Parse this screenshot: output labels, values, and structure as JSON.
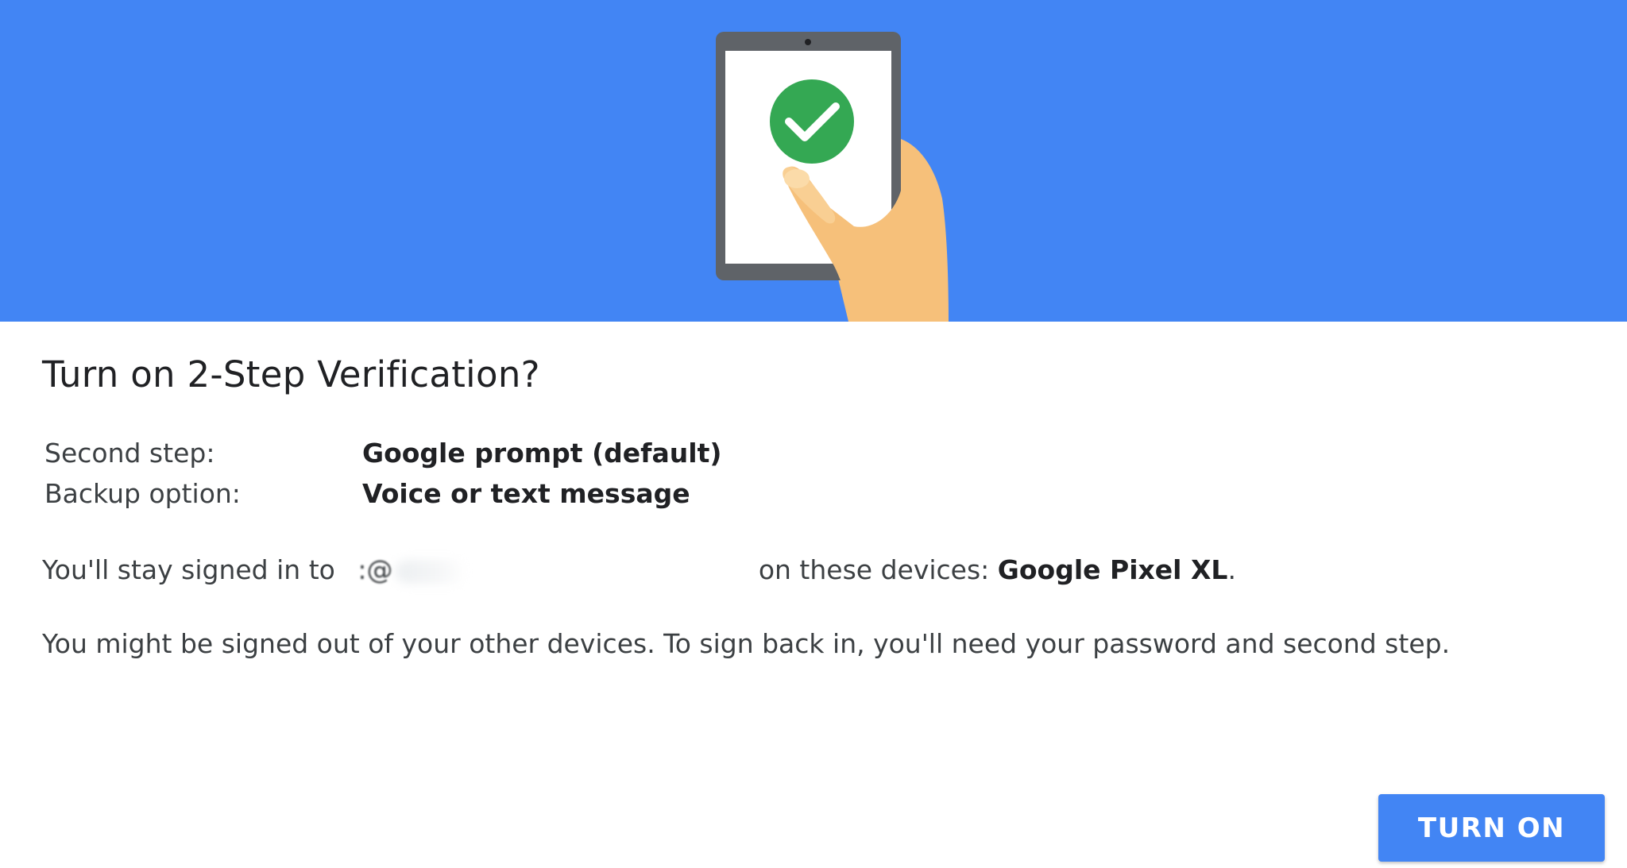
{
  "dialog": {
    "title": "Turn on 2-Step Verification?",
    "summary": {
      "second_step_label": "Second step:",
      "second_step_value": "Google prompt (default)",
      "backup_label": "Backup option:",
      "backup_value": "Voice or text message"
    },
    "signed_in": {
      "prefix": "You'll stay signed in to",
      "email_visible": ":@",
      "middle": "on these devices:",
      "device": "Google Pixel XL",
      "suffix": "."
    },
    "warning": "You might be signed out of your other devices. To sign back in, you'll need your password and second step.",
    "turn_on_button": "TURN ON"
  },
  "illustration": {
    "icon": "phone-checkmark-icon",
    "colors": {
      "background": "#4285f4",
      "phone_body": "#5f6368",
      "screen": "#ffffff",
      "check_circle": "#34a853",
      "hand": "#f6c07a"
    }
  },
  "colors": {
    "accent": "#4285f4",
    "text_primary": "#202124",
    "text_secondary": "#3c4043"
  }
}
